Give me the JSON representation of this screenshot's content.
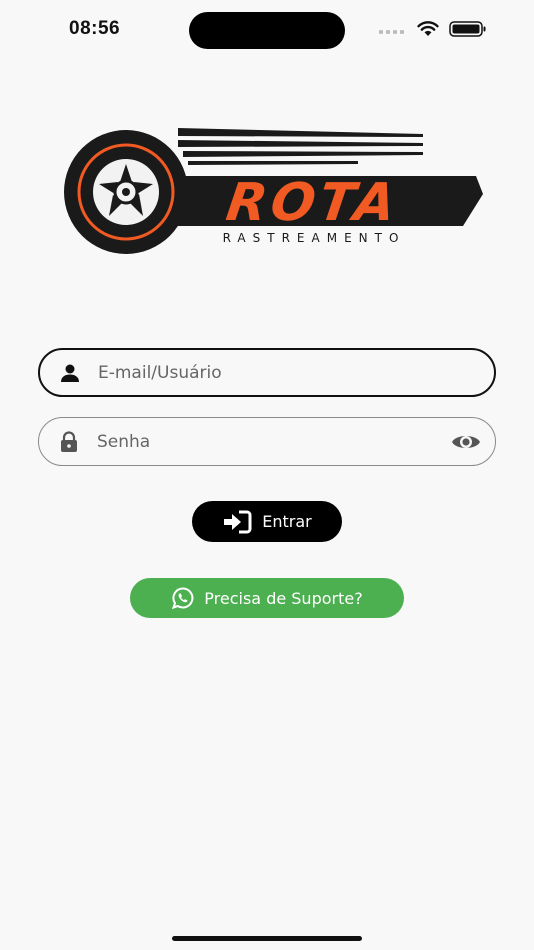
{
  "status_bar": {
    "time": "08:56",
    "icons": [
      "signal-icon",
      "wifi-icon",
      "battery-icon"
    ]
  },
  "logo": {
    "brand": "ROTA",
    "tagline": "RASTREAMENTO",
    "colors": {
      "orange": "#f15a22",
      "dark": "#1a1a1a"
    }
  },
  "login_form": {
    "username": {
      "placeholder": "E-mail/Usuário",
      "value": "",
      "icon": "person-icon"
    },
    "password": {
      "placeholder": "Senha",
      "value": "",
      "icon": "lock-icon",
      "toggle_icon": "eye-icon"
    },
    "submit": {
      "label": "Entrar",
      "icon": "login-arrow-icon"
    }
  },
  "support": {
    "label": "Precisa de Suporte?",
    "icon": "whatsapp-icon",
    "color": "#4caf50"
  }
}
